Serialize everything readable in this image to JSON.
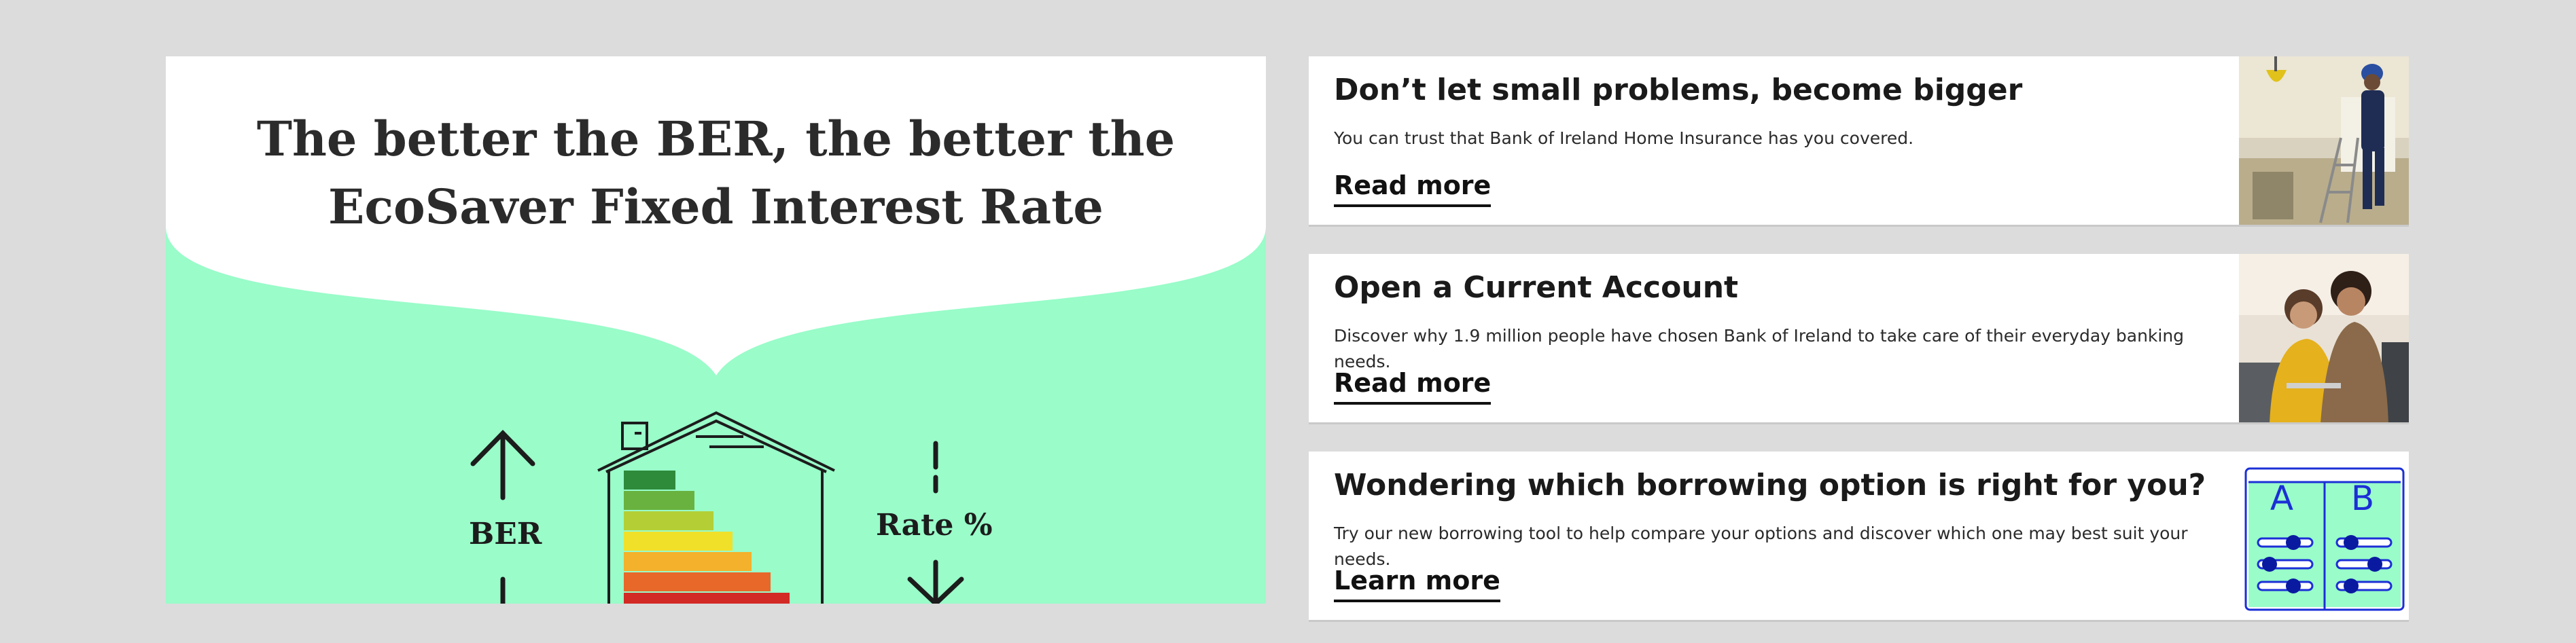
{
  "hero": {
    "line1": "The better the BER, the better the",
    "line2": "EcoSaver Fixed Interest Rate",
    "ber_label": "BER",
    "rate_label": "Rate %",
    "colors": {
      "background": "#99fcc9",
      "bubble": "#ffffff"
    }
  },
  "cards": [
    {
      "title": "Don’t let small problems, become bigger",
      "description": "You can trust that Bank of Ireland Home Insurance has you covered.",
      "link": "Read more",
      "image": "man-on-ladder-photo"
    },
    {
      "title": "Open a Current Account",
      "description": "Discover why 1.9 million people have chosen Bank of Ireland to take care of their everyday banking needs.",
      "link": "Read more",
      "image": "couple-on-sofa-photo"
    },
    {
      "title": "Wondering which borrowing option is right for you?",
      "description": "Try our new borrowing tool to help compare your options and discover which one may best suit your needs.",
      "link": "Learn more",
      "image": "compare-sliders-icon",
      "compare_a": "A",
      "compare_b": "B"
    }
  ]
}
